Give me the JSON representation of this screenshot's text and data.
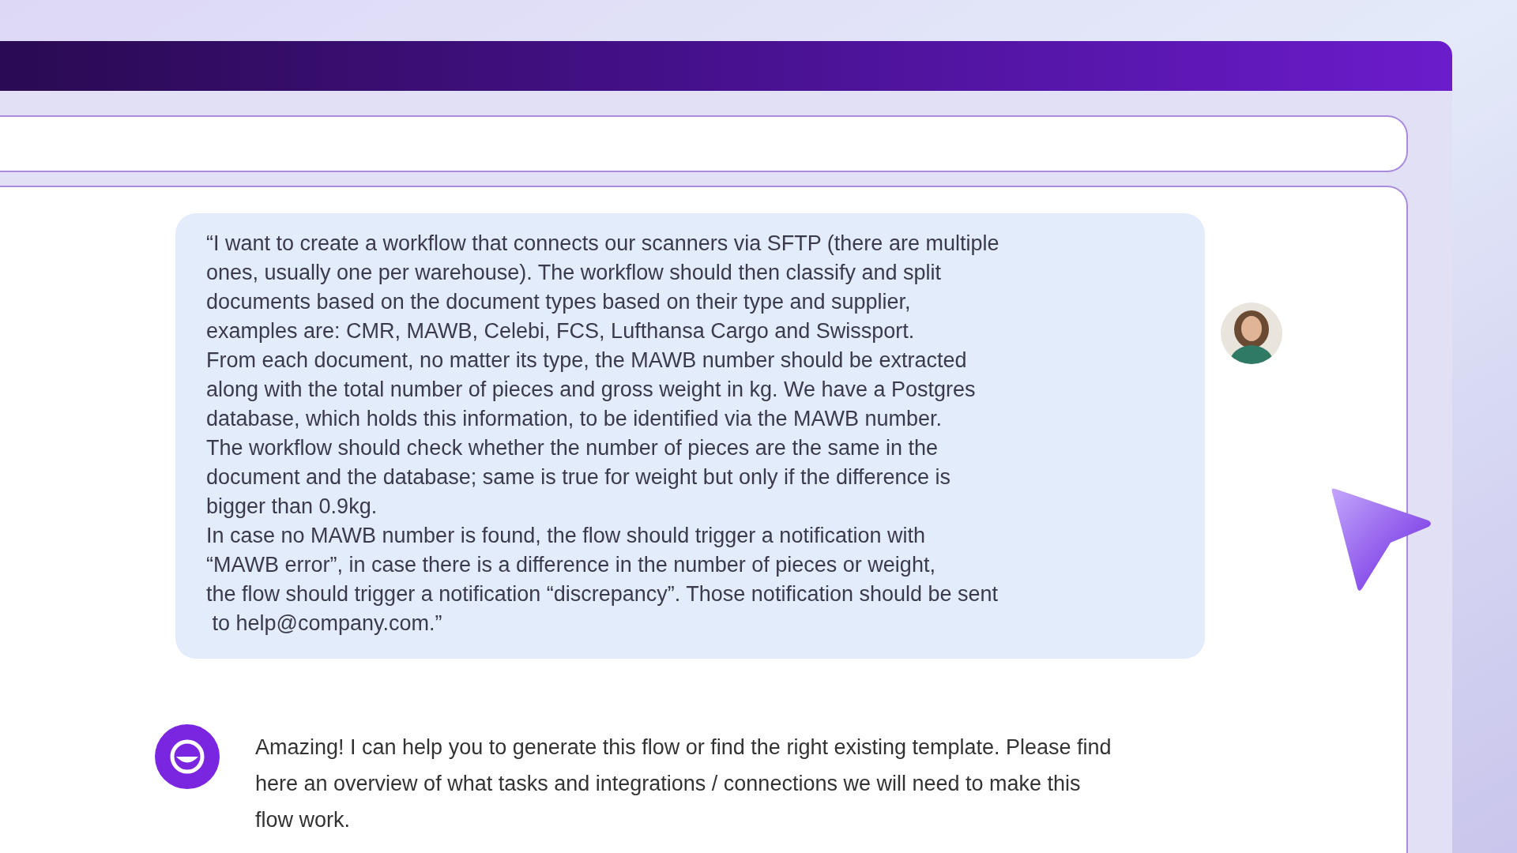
{
  "messages": [
    {
      "kind": "user",
      "lines": [
        "“I want to create a workflow that connects our scanners via SFTP (there are multiple",
        "ones, usually one per warehouse). The workflow should then classify and split",
        "documents based on the document types based on their type and supplier,",
        "examples are: CMR, MAWB, Celebi, FCS, Lufthansa Cargo and Swissport.",
        "From each document, no matter its type, the MAWB number should be extracted",
        "along with the total number of pieces and gross weight in kg. We have a Postgres",
        "database, which holds this information, to be identified via the MAWB number.",
        "The workflow should check whether the number of pieces are the same in the",
        "document and the database; same is true for weight but only if the difference is",
        "bigger than 0.9kg.",
        "In case no MAWB number is found, the flow should trigger a notification with",
        "“MAWB error”, in case there is a difference in the number of pieces or weight,",
        "the flow should trigger a notification “discrepancy”. Those notification should be sent",
        " to help@company.com.”"
      ]
    },
    {
      "kind": "assistant",
      "lines": [
        "Amazing! I can help you to generate this flow or find the right existing template. Please find",
        "here an overview of what tasks and integrations / connections we will need to make this",
        "flow work."
      ]
    }
  ]
}
